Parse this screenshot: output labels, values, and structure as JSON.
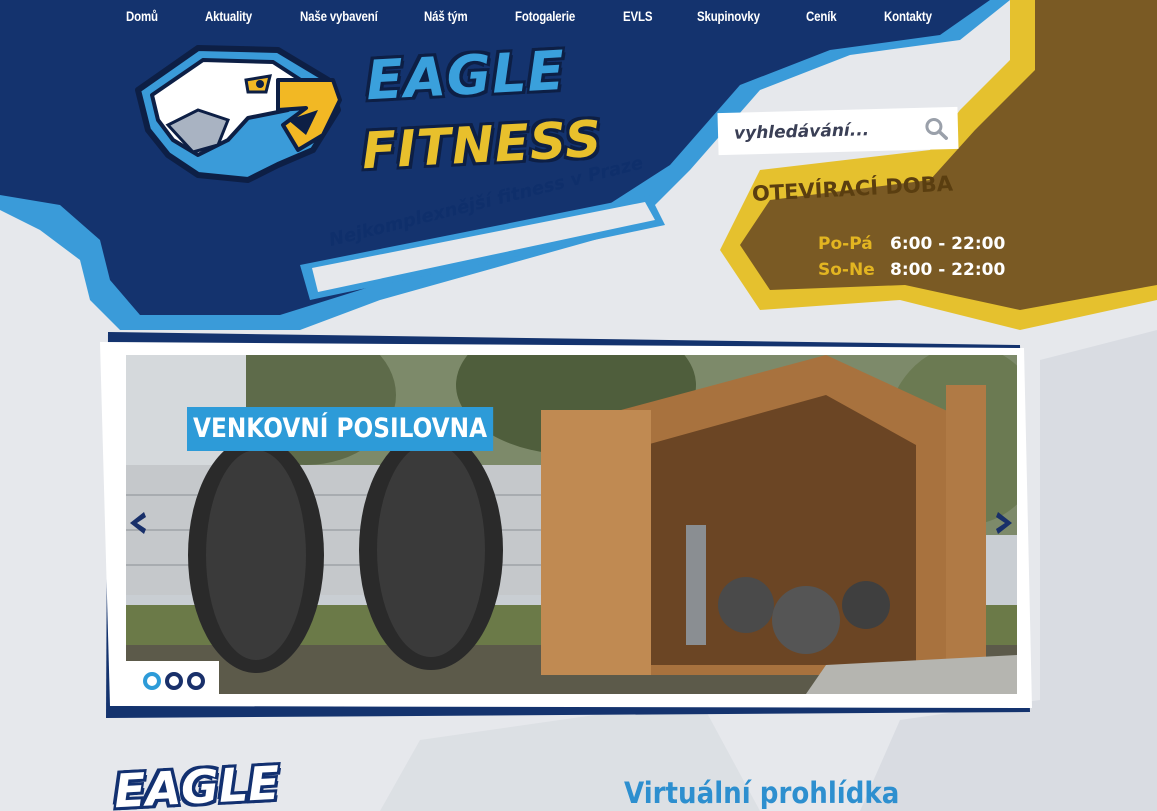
{
  "nav": {
    "items": [
      {
        "label": "Domů"
      },
      {
        "label": "Aktuality"
      },
      {
        "label": "Naše vybavení"
      },
      {
        "label": "Náš tým"
      },
      {
        "label": "Fotogalerie"
      },
      {
        "label": "EVLS"
      },
      {
        "label": "Skupinovky"
      },
      {
        "label": "Ceník"
      },
      {
        "label": "Kontakty"
      }
    ]
  },
  "logo": {
    "line1": "EAGLE",
    "line2": "FITNESS"
  },
  "tagline": "Nejkomplexnější fitness v Praze",
  "search": {
    "placeholder": "vyhledávání...",
    "icon": "search-icon"
  },
  "hours": {
    "title": "OTEVÍRACÍ DOBA",
    "rows": [
      {
        "day": "Po-Pá",
        "time": "6:00 - 22:00"
      },
      {
        "day": "So-Ne",
        "time": "8:00 - 22:00"
      }
    ]
  },
  "slider": {
    "caption": "VENKOVNÍ POSILOVNA",
    "prev_icon": "chevron-left-icon",
    "next_icon": "chevron-right-icon",
    "dots": 3,
    "active_dot": 1
  },
  "bottom": {
    "logo_text": "EAGLE",
    "virtual_tour_title": "Virtuální prohlídka"
  },
  "colors": {
    "navy": "#14336e",
    "accent_blue": "#2d9bd8",
    "gold": "#e3b521",
    "brown": "#7a5a24",
    "background": "#e6e8ec"
  }
}
